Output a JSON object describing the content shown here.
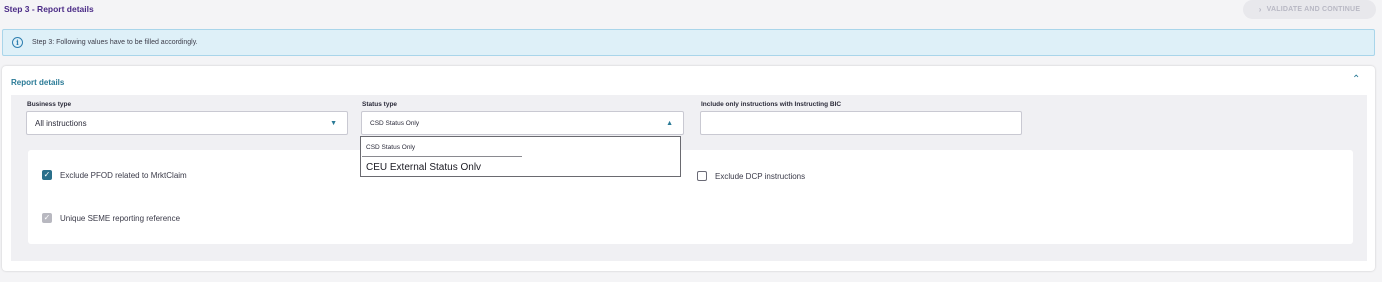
{
  "header": {
    "step_title": "Step 3 - Report details",
    "validate_label": "VALIDATE AND CONTINUE"
  },
  "banner": {
    "text": "Step 3: Following values have to be filled accordingly."
  },
  "card": {
    "title": "Report details",
    "business_type": {
      "label": "Business type",
      "value": "All instructions"
    },
    "status_type": {
      "label": "Status type",
      "value": "CSD Status Only",
      "options": [
        "CSD Status Only",
        "CEU External Status Onlv"
      ]
    },
    "instructing_bic": {
      "label": "Include only instructions with Instructing BIC",
      "value": ""
    },
    "checkboxes": {
      "exclude_pfod": {
        "label": "Exclude PFOD related to MrktClaim",
        "checked": true
      },
      "unique_seme": {
        "label": "Unique SEME reporting reference",
        "checked": true,
        "disabled": true
      },
      "exclude_dcp": {
        "label": "Exclude DCP instructions",
        "checked": false
      }
    }
  },
  "colors": {
    "accent": "#2a7a96",
    "step_title": "#4a2a86",
    "banner_bg": "#def0f8",
    "checkbox_checked": "#2a6f8a"
  }
}
